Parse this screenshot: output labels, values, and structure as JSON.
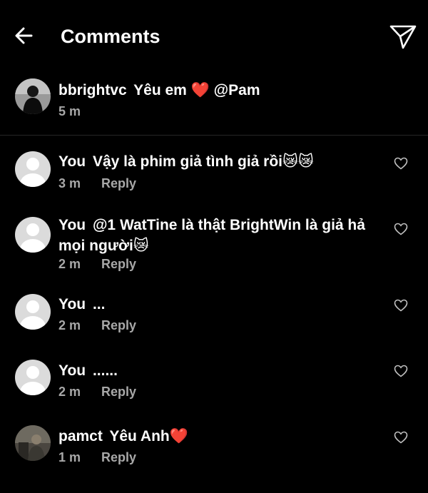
{
  "header": {
    "title": "Comments"
  },
  "caption": {
    "user": "bbrightvc",
    "text": "Yêu em ❤️ @Pam",
    "time": "5 m"
  },
  "comments": [
    {
      "user": "You",
      "text": "Vậy là phim giả tình giả rồi😿😿",
      "time": "3 m",
      "reply": "Reply"
    },
    {
      "user": "You",
      "text": "@1 WatTine là thật BrightWin là giả hả mọi người😿",
      "time": "2 m",
      "reply": "Reply"
    },
    {
      "user": "You",
      "text": "...",
      "time": "2 m",
      "reply": "Reply"
    },
    {
      "user": "You",
      "text": "......",
      "time": "2 m",
      "reply": "Reply"
    },
    {
      "user": "pamct",
      "text": "Yêu Anh❤️",
      "time": "1 m",
      "reply": "Reply"
    }
  ],
  "icons": {
    "back": "arrow-left-icon",
    "send": "paper-plane-icon",
    "like": "heart-outline-icon"
  },
  "colors": {
    "background": "#000000",
    "text": "#ffffff",
    "secondary": "#a8a8a8",
    "divider": "#262626"
  }
}
